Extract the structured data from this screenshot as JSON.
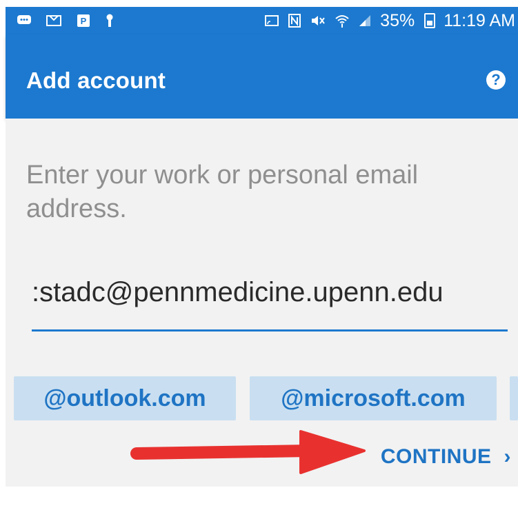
{
  "status_bar": {
    "battery_percent": "35%",
    "time": "11:19 AM",
    "left_icons": [
      "chat-icon",
      "inbox-icon",
      "app-icon",
      "keyhole-icon"
    ],
    "right_icons": [
      "cast-icon",
      "nfc-icon",
      "mute-icon",
      "wifi-icon",
      "signal-icon",
      "battery-icon"
    ]
  },
  "app_bar": {
    "title": "Add account",
    "help_label": "?"
  },
  "form": {
    "prompt": "Enter your work or personal email address.",
    "email_value": ":stadc@pennmedicine.upenn.edu"
  },
  "suggestions": [
    {
      "label": "@outlook.com"
    },
    {
      "label": "@microsoft.com"
    }
  ],
  "actions": {
    "continue_label": "CONTINUE",
    "continue_chevron": "›"
  },
  "colors": {
    "primary": "#1c79cf",
    "chip_bg": "#c9dff1",
    "chip_text": "#1f74c4",
    "arrow": "#e8312f",
    "content_bg": "#f2f2f2"
  }
}
